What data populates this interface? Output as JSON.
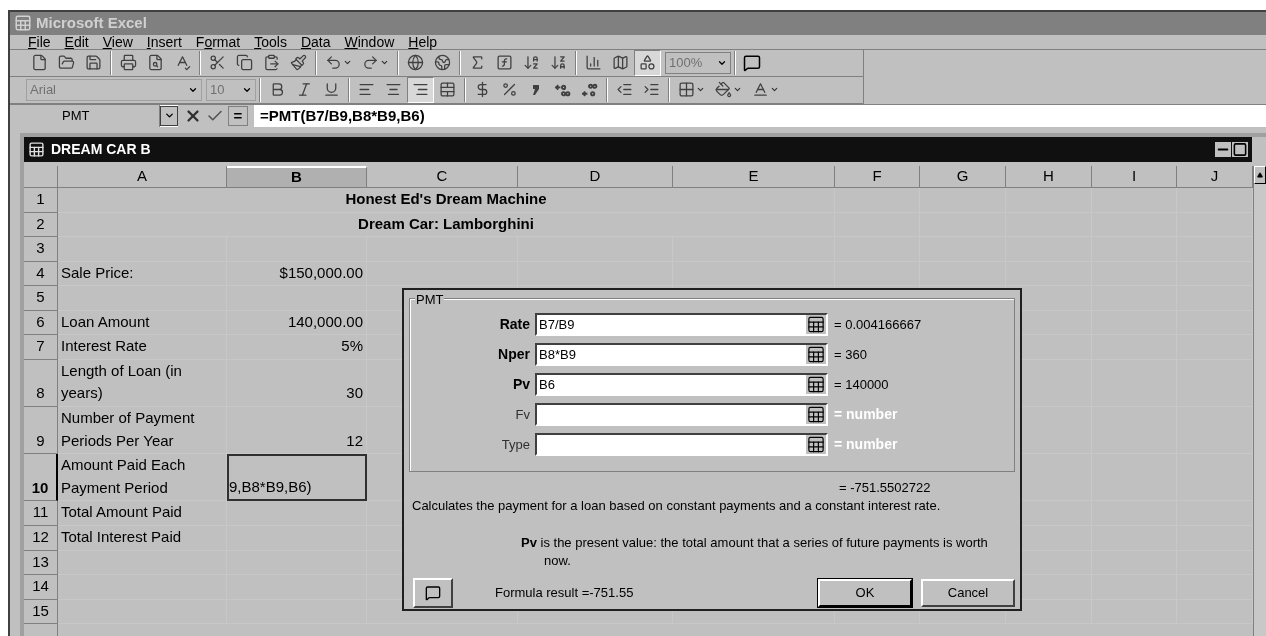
{
  "app": {
    "title": "Microsoft Excel"
  },
  "menu": [
    {
      "label": "File"
    },
    {
      "label": "Edit"
    },
    {
      "label": "View"
    },
    {
      "label": "Insert"
    },
    {
      "label": "Format"
    },
    {
      "label": "Tools"
    },
    {
      "label": "Data"
    },
    {
      "label": "Window"
    },
    {
      "label": "Help"
    }
  ],
  "standard_toolbar": {
    "zoom": "100%",
    "buttons": [
      {
        "pressed": false
      },
      {
        "pressed": false
      },
      {
        "pressed": false
      },
      {
        "pressed": false
      },
      {
        "pressed": false
      },
      {
        "pressed": false
      },
      {
        "pressed": false
      },
      {
        "pressed": false
      },
      {
        "pressed": false
      },
      {
        "pressed": false
      },
      {
        "pressed": false
      },
      {
        "pressed": false
      },
      {
        "pressed": false
      },
      {
        "pressed": false
      },
      {
        "pressed": false
      },
      {
        "pressed": false
      },
      {
        "pressed": false
      },
      {
        "pressed": false
      },
      {
        "pressed": false
      },
      {
        "pressed": false
      },
      {
        "pressed": true
      }
    ]
  },
  "formatting_toolbar": {
    "font": "Arial",
    "size": "10",
    "buttons": [
      {
        "pressed": false
      },
      {
        "pressed": false
      },
      {
        "pressed": false
      },
      {
        "pressed": false
      },
      {
        "pressed": false
      },
      {
        "pressed": true
      },
      {
        "pressed": false
      },
      {
        "pressed": false
      },
      {
        "pressed": false
      },
      {
        "pressed": false
      },
      {
        "pressed": false
      },
      {
        "pressed": false
      },
      {
        "pressed": false
      },
      {
        "pressed": false
      },
      {
        "pressed": false
      },
      {
        "pressed": false
      },
      {
        "pressed": false
      }
    ]
  },
  "formula_bar": {
    "name_box": "PMT",
    "equals": "=",
    "formula": "=PMT(B7/B9,B8*B9,B6)"
  },
  "workbook": {
    "title": "DREAM CAR B",
    "columns": [
      {
        "label": "A",
        "selected": false
      },
      {
        "label": "B",
        "selected": true
      },
      {
        "label": "C",
        "selected": false
      },
      {
        "label": "D",
        "selected": false
      },
      {
        "label": "E",
        "selected": false
      },
      {
        "label": "F",
        "selected": false
      },
      {
        "label": "G",
        "selected": false
      },
      {
        "label": "H",
        "selected": false
      },
      {
        "label": "I",
        "selected": false
      },
      {
        "label": "J",
        "selected": false
      }
    ],
    "rows": [
      {
        "header": "1",
        "selected": false,
        "kind": "title",
        "text": "Honest Ed's Dream Machine"
      },
      {
        "header": "2",
        "selected": false,
        "kind": "title",
        "text": "Dream Car: Lamborghini"
      },
      {
        "header": "3",
        "selected": false,
        "kind": "data"
      },
      {
        "header": "4",
        "selected": false,
        "kind": "data",
        "label": "Sale Price:",
        "value": "$150,000.00"
      },
      {
        "header": "5",
        "selected": false,
        "kind": "data"
      },
      {
        "header": "6",
        "selected": false,
        "kind": "data",
        "label": "Loan Amount",
        "value": "140,000.00"
      },
      {
        "header": "7",
        "selected": false,
        "kind": "data",
        "label": "Interest Rate",
        "value": "5%"
      },
      {
        "header": "8",
        "selected": false,
        "kind": "data",
        "label": "Length of Loan (in years)",
        "value": "30"
      },
      {
        "header": "9",
        "selected": false,
        "kind": "data",
        "label": "Number of Payment Periods Per Year",
        "value": "12"
      },
      {
        "header": "10",
        "selected": true,
        "kind": "editing",
        "label": "Amount Paid Each Payment Period",
        "value": "9,B8*B9,B6)"
      },
      {
        "header": "11",
        "selected": false,
        "kind": "data",
        "label": "Total Amount Paid"
      },
      {
        "header": "12",
        "selected": false,
        "kind": "data",
        "label": "Total Interest Paid"
      },
      {
        "header": "13",
        "selected": false,
        "kind": "data"
      },
      {
        "header": "14",
        "selected": false,
        "kind": "data"
      },
      {
        "header": "15",
        "selected": false,
        "kind": "data"
      }
    ]
  },
  "dialog": {
    "title": "PMT",
    "args": [
      {
        "label": "Rate",
        "value": "B7/B9",
        "result": "= 0.004166667",
        "required": true,
        "hint": false
      },
      {
        "label": "Nper",
        "value": "B8*B9",
        "result": "= 360",
        "required": true,
        "hint": false
      },
      {
        "label": "Pv",
        "value": "B6",
        "result": "= 140000",
        "required": true,
        "hint": false
      },
      {
        "label": "Fv",
        "result": "= number",
        "required": false,
        "hint": true
      },
      {
        "label": "Type",
        "result": "= number",
        "required": false,
        "hint": true
      }
    ],
    "result": "= -751.5502722",
    "description": "Calculates the payment for a loan based on constant payments and a constant interest rate.",
    "arg_help": "**Pv** is the present value: the total amount that a series of future payments is worth now.",
    "formula_result": "Formula result =-751.55",
    "buttons": [
      {
        "label": "OK",
        "default": true
      },
      {
        "label": "Cancel",
        "default": false
      }
    ]
  }
}
